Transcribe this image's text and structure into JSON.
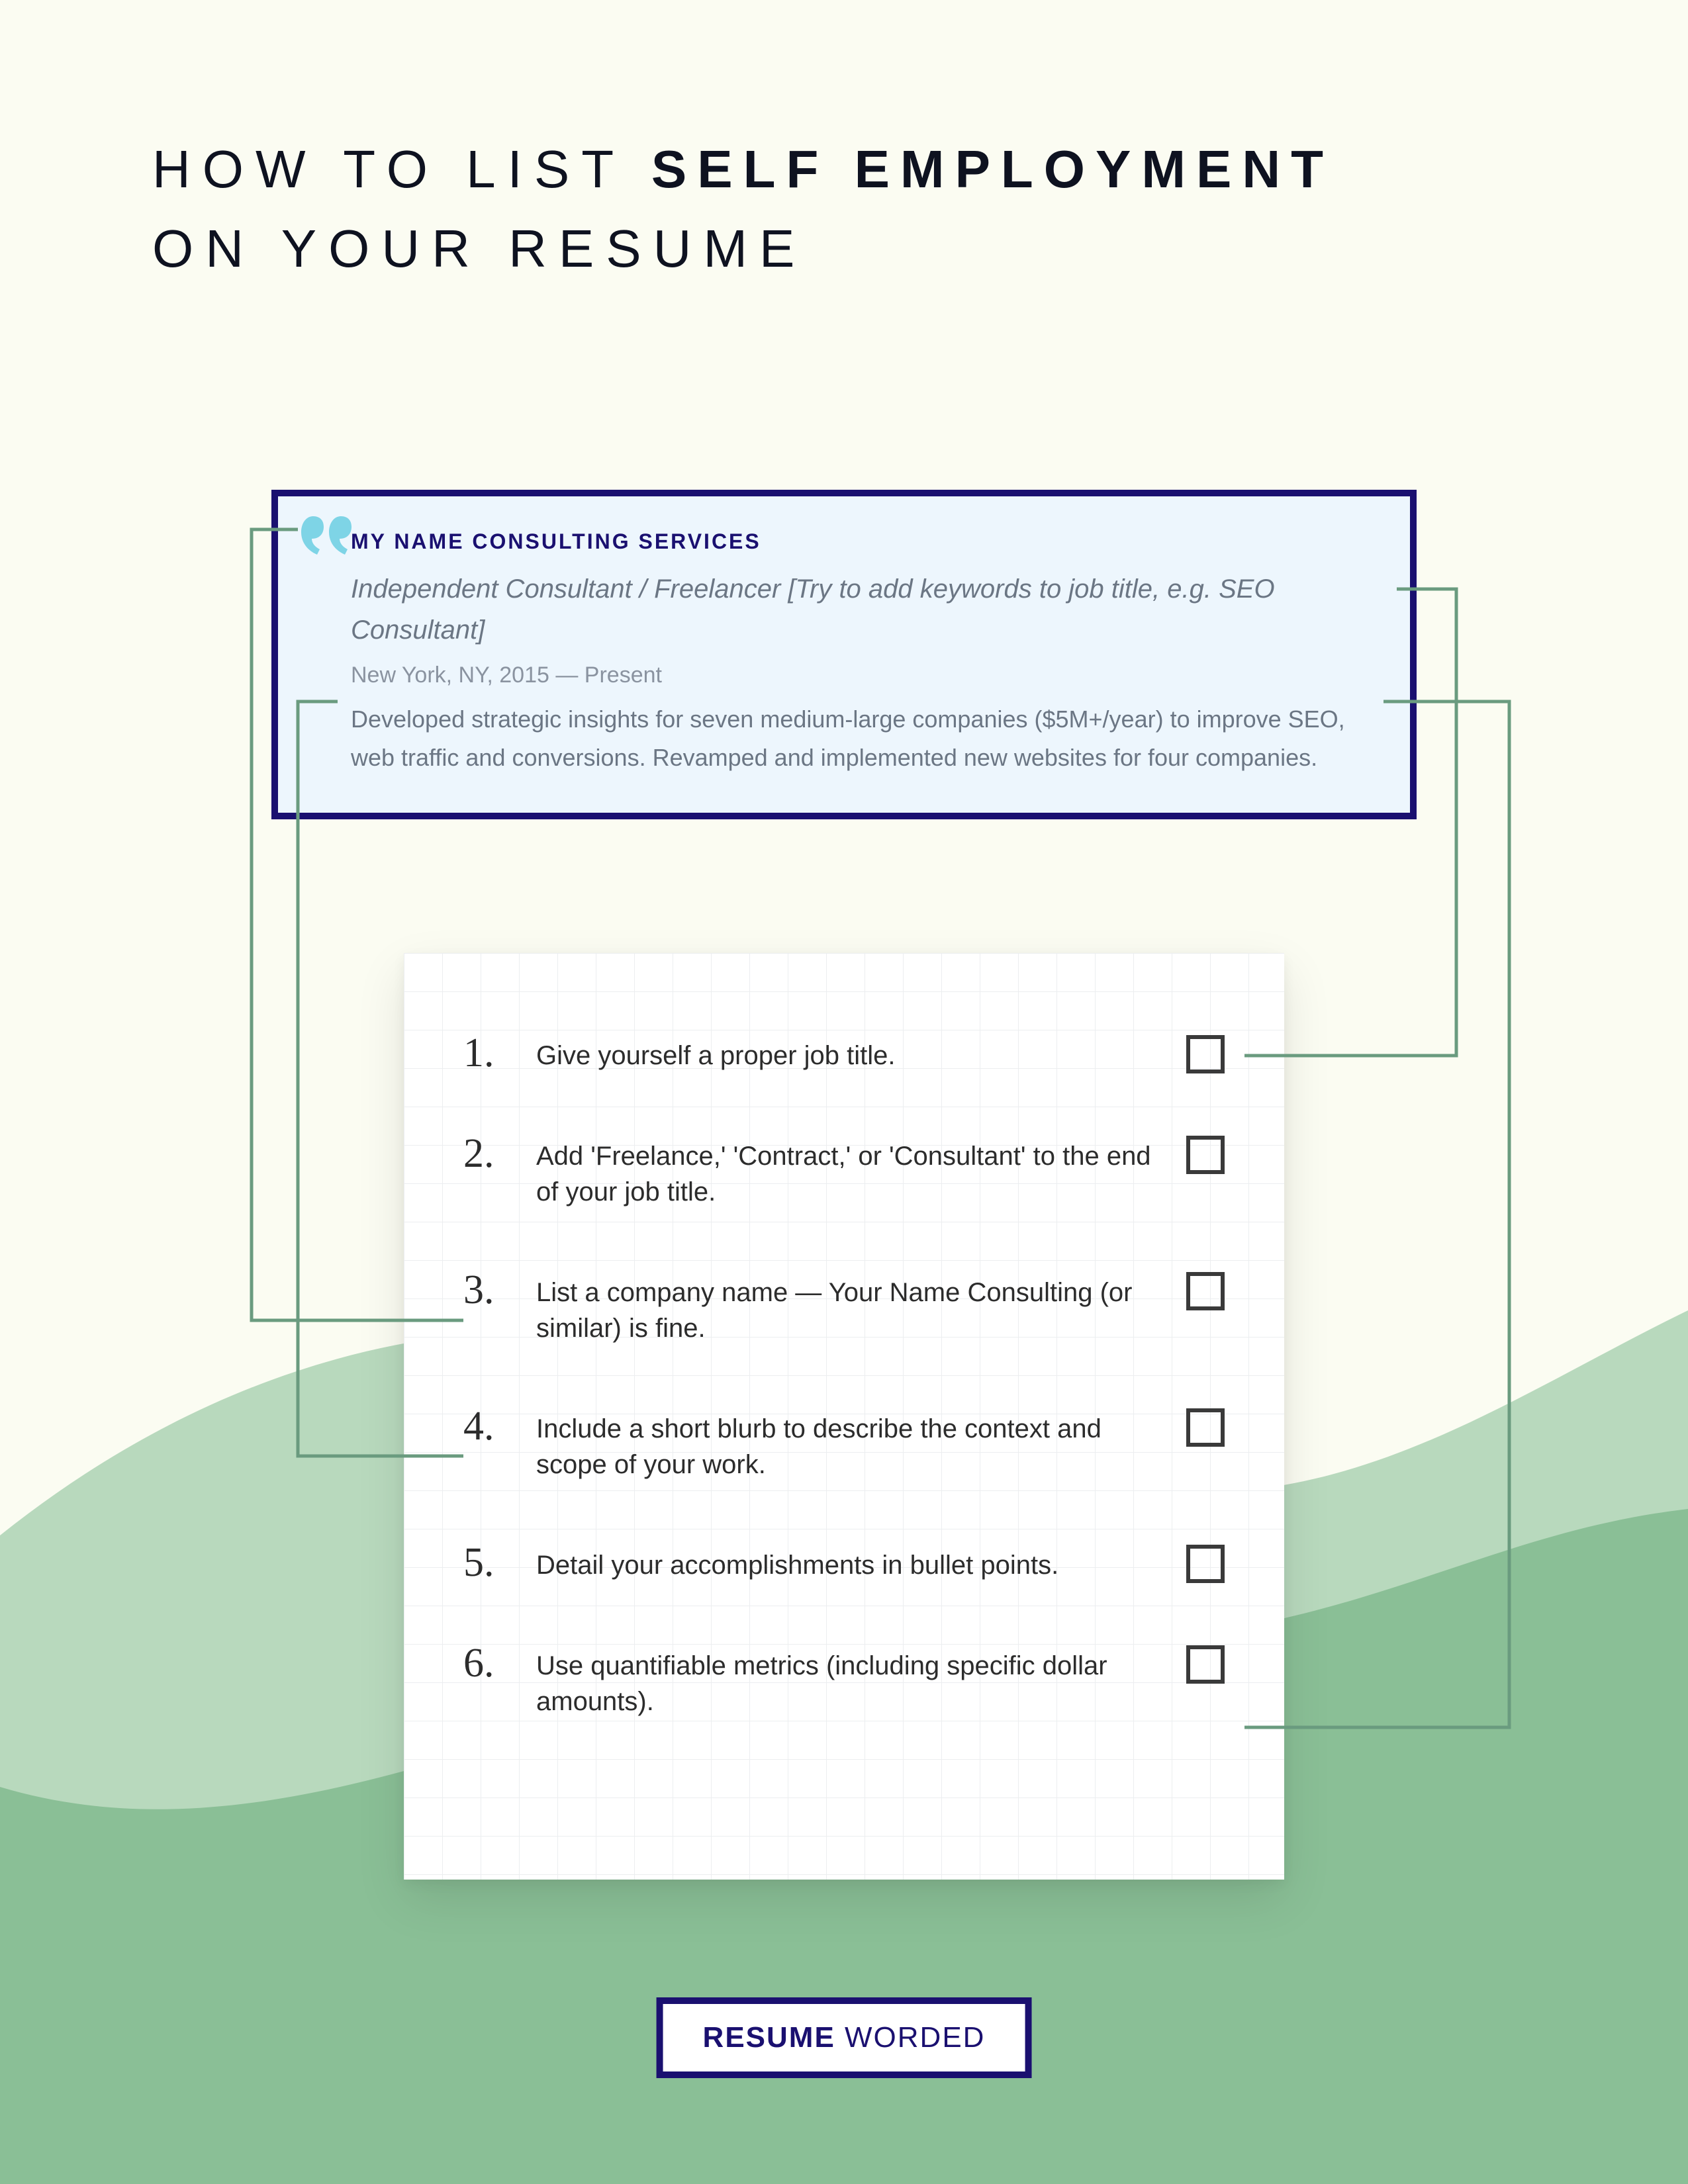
{
  "header": {
    "line1_pre": "How to list ",
    "line1_bold": "Self Employment",
    "line2": "on your resume"
  },
  "sample": {
    "company": "MY NAME CONSULTING SERVICES",
    "job_title": "Independent Consultant / Freelancer [Try to add keywords to job title, e.g. SEO Consultant]",
    "meta": "New York, NY, 2015 — Present",
    "description": "Developed strategic insights for seven medium-large companies ($5M+/year) to improve SEO, web traffic and conversions. Revamped and implemented new websites for four companies."
  },
  "checklist": [
    {
      "num": "1.",
      "text": "Give yourself a proper job title."
    },
    {
      "num": "2.",
      "text": "Add 'Freelance,' 'Contract,' or 'Consultant' to the end of your job title."
    },
    {
      "num": "3.",
      "text": "List a company name — Your Name Consulting (or similar) is fine."
    },
    {
      "num": "4.",
      "text": "Include a short blurb to describe the context and scope of your work."
    },
    {
      "num": "5.",
      "text": "Detail your accomplishments in bullet points."
    },
    {
      "num": "6.",
      "text": "Use quantifiable metrics (including specific dollar amounts)."
    }
  ],
  "logo": {
    "part1": "RESUME",
    "part2": " WORDED"
  }
}
